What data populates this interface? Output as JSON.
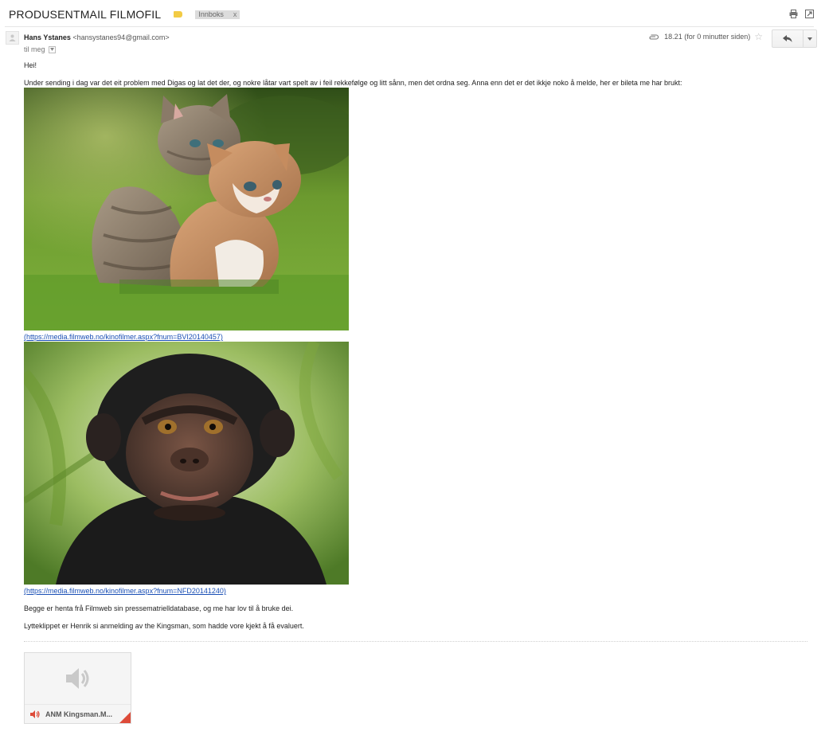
{
  "header": {
    "subject": "PRODUSENTMAIL FILMOFIL",
    "label_chip": "Innboks",
    "chip_close": "x",
    "icons": [
      "label-icon",
      "print-icon",
      "new-window-icon"
    ]
  },
  "message": {
    "sender_name": "Hans Ystanes",
    "sender_email": "<hansystanes94@gmail.com>",
    "recipient": "til meg",
    "timestamp": "18.21 (for 0 minutter siden)",
    "icons": [
      "attachment-clip-icon",
      "star-icon",
      "reply-icon",
      "more-caret-icon"
    ],
    "greeting": "Hei!",
    "paragraph_1": "Under sending i dag var det eit problem med Digas og lat det der, og nokre låtar vart spelt av i feil rekkefølge og litt sånn, men det ordna seg. Anna enn det er det ikkje noko å melde, her er bileta me har brukt:",
    "image_1_name": "kittens-photo",
    "link_1": "(https://media.filmweb.no/kinofilmer.aspx?fnum=BVI20140457)",
    "image_2_name": "bonobo-photo",
    "link_2": "(https://media.filmweb.no/kinofilmer.aspx?fnum=NFD20141240)",
    "paragraph_2": "Begge er henta frå Filmweb sin pressematrielldatabase, og me har lov til å bruke dei.",
    "paragraph_3": "Lytteklippet er Henrik si anmelding av the Kingsman, som hadde vore kjekt å få evaluert."
  },
  "attachment": {
    "filename": "ANM Kingsman.M...",
    "icon": "audio-speaker-icon",
    "accent_color": "#dd4b39"
  }
}
